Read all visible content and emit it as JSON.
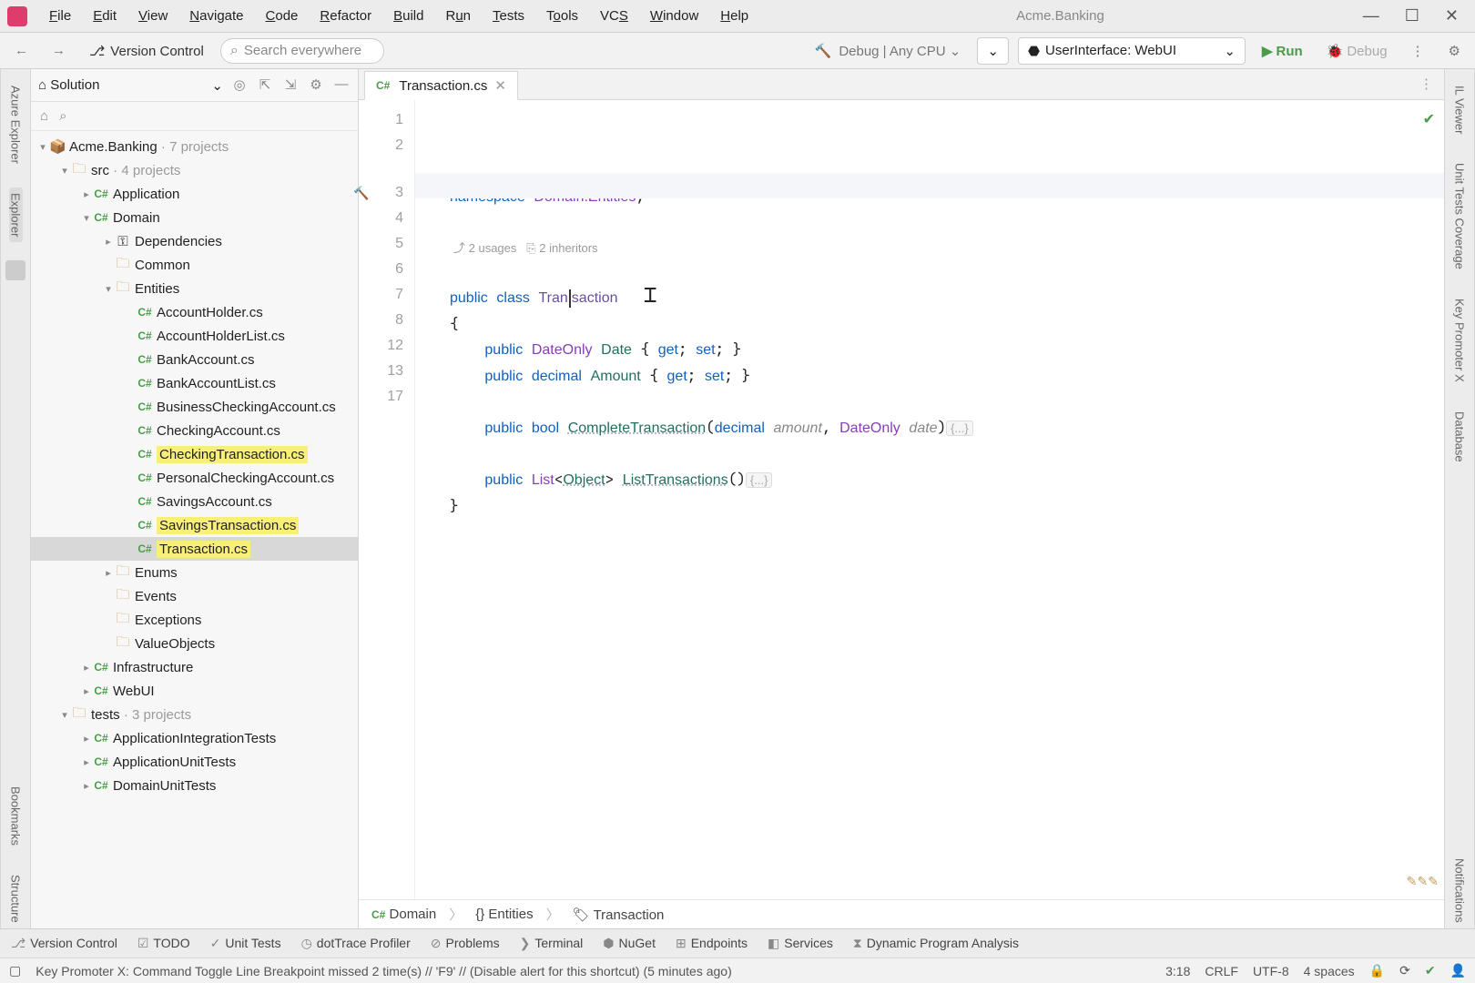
{
  "window": {
    "title": "Acme.Banking"
  },
  "menu": [
    "File",
    "Edit",
    "View",
    "Navigate",
    "Code",
    "Refactor",
    "Build",
    "Run",
    "Tests",
    "Tools",
    "VCS",
    "Window",
    "Help"
  ],
  "toolbar": {
    "version_control": "Version Control",
    "search_placeholder": "Search everywhere",
    "build_config": "Debug | Any CPU",
    "run_config": "UserInterface: WebUI",
    "run": "Run",
    "debug": "Debug"
  },
  "left_tabs": {
    "azure": "Azure Explorer",
    "explorer": "Explorer",
    "bookmarks": "Bookmarks",
    "structure": "Structure"
  },
  "right_tabs": {
    "il": "IL Viewer",
    "ut": "Unit Tests Coverage",
    "kp": "Key Promoter X",
    "db": "Database",
    "notif": "Notifications"
  },
  "solution": {
    "header": "Solution",
    "root": "Acme.Banking",
    "root_hint": "7 projects",
    "src": "src",
    "src_hint": "4 projects",
    "projects": {
      "application": "Application",
      "domain": "Domain",
      "infrastructure": "Infrastructure",
      "webui": "WebUI"
    },
    "domain_children": {
      "dependencies": "Dependencies",
      "common": "Common",
      "entities": "Entities",
      "enums": "Enums",
      "events": "Events",
      "exceptions": "Exceptions",
      "valueobjects": "ValueObjects"
    },
    "entities": [
      "AccountHolder.cs",
      "AccountHolderList.cs",
      "BankAccount.cs",
      "BankAccountList.cs",
      "BusinessCheckingAccount.cs",
      "CheckingAccount.cs",
      "CheckingTransaction.cs",
      "PersonalCheckingAccount.cs",
      "SavingsAccount.cs",
      "SavingsTransaction.cs",
      "Transaction.cs"
    ],
    "tests": "tests",
    "tests_hint": "3 projects",
    "test_projects": [
      "ApplicationIntegrationTests",
      "ApplicationUnitTests",
      "DomainUnitTests"
    ]
  },
  "tab": {
    "label": "Transaction.cs"
  },
  "code": {
    "ns_kw": "namespace",
    "ns": "Domain.Entities",
    "hint_usages": "2 usages",
    "hint_inh": "2 inheritors",
    "public": "public",
    "class": "class",
    "classname": "Transaction",
    "dateonly": "DateOnly",
    "date_prop": "Date",
    "get": "get",
    "set": "set",
    "decimal": "decimal",
    "amount_prop": "Amount",
    "bool": "bool",
    "complete": "CompleteTransaction",
    "amount_p": "amount",
    "date_p": "date",
    "list": "List",
    "object": "Object",
    "listm": "ListTransactions",
    "line_numbers": [
      "1",
      "2",
      "3",
      "4",
      "5",
      "6",
      "7",
      "8",
      "12",
      "13",
      "17"
    ]
  },
  "crumbs": {
    "a": "Domain",
    "b": "Entities",
    "c": "Transaction"
  },
  "bottom": {
    "vc": "Version Control",
    "todo": "TODO",
    "ut": "Unit Tests",
    "dot": "dotTrace Profiler",
    "prob": "Problems",
    "term": "Terminal",
    "nuget": "NuGet",
    "end": "Endpoints",
    "svc": "Services",
    "dpa": "Dynamic Program Analysis"
  },
  "status": {
    "msg": "Key Promoter X: Command Toggle Line Breakpoint missed 2 time(s) // 'F9' // (Disable alert for this shortcut) (5 minutes ago)",
    "pos": "3:18",
    "eol": "CRLF",
    "enc": "UTF-8",
    "indent": "4 spaces"
  }
}
